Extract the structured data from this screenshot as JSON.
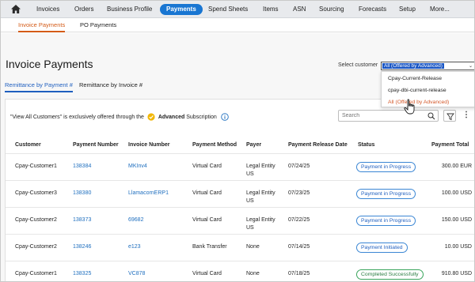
{
  "nav": {
    "items": [
      {
        "label": "Invoices"
      },
      {
        "label": "Orders"
      },
      {
        "label": "Business Profile"
      },
      {
        "label": "Payments"
      },
      {
        "label": "Spend Sheets"
      },
      {
        "label": "Items"
      },
      {
        "label": "ASN"
      },
      {
        "label": "Sourcing"
      },
      {
        "label": "Forecasts"
      },
      {
        "label": "Setup"
      },
      {
        "label": "More..."
      }
    ],
    "active_index": 3
  },
  "subnav": {
    "items": [
      {
        "label": "Invoice Payments"
      },
      {
        "label": "PO Payments"
      }
    ],
    "active_index": 0
  },
  "page": {
    "title": "Invoice Payments",
    "customer_label": "Select customer",
    "customer_selected": "All (Offered by Advanced)",
    "customer_options": [
      "Cpay-Current-Release",
      "cpay-dbi-current-release",
      "All (Offered by Advanced)"
    ]
  },
  "tabs": [
    {
      "label": "Remittance by Payment #"
    },
    {
      "label": "Remittance by Invoice #"
    }
  ],
  "notice": {
    "prefix": "\"View All Customers\" is exclusively offered through the",
    "highlight": "Advanced",
    "suffix": "Subscription"
  },
  "search": {
    "placeholder": "Search"
  },
  "more_label": "⋮",
  "table": {
    "headers": [
      "Customer",
      "Payment Number",
      "Invoice Number",
      "Payment Method",
      "Payer",
      "Payment Release Date",
      "Status",
      "Payment Total"
    ],
    "rows": [
      {
        "customer": "Cpay-Customer1",
        "payment_number": "138384",
        "invoice_number": "MKInv4",
        "method": "Virtual Card",
        "payer_1": "Legal Entity",
        "payer_2": "US",
        "date": "07/24/25",
        "status": "Payment in Progress",
        "total": "300.00 EUR"
      },
      {
        "customer": "Cpay-Customer3",
        "payment_number": "138380",
        "invoice_number": "LlamacornERP1",
        "method": "Virtual Card",
        "payer_1": "Legal Entity",
        "payer_2": "US",
        "date": "07/23/25",
        "status": "Payment in Progress",
        "total": "100.00 USD"
      },
      {
        "customer": "Cpay-Customer2",
        "payment_number": "138373",
        "invoice_number": "69682",
        "method": "Virtual Card",
        "payer_1": "Legal Entity",
        "payer_2": "US",
        "date": "07/22/25",
        "status": "Payment in Progress",
        "total": "150.00 USD"
      },
      {
        "customer": "Cpay-Customer2",
        "payment_number": "138246",
        "invoice_number": "e123",
        "method": "Bank Transfer",
        "payer_1": "None",
        "payer_2": "",
        "date": "07/14/25",
        "status": "Payment Initiated",
        "total": "10.00 USD"
      },
      {
        "customer": "Cpay-Customer1",
        "payment_number": "138325",
        "invoice_number": "VC878",
        "method": "Virtual Card",
        "payer_1": "None",
        "payer_2": "",
        "date": "07/18/25",
        "status": "Completed Successfully",
        "total": "910.80 USD"
      }
    ]
  },
  "colors": {
    "accent_blue": "#1976d2",
    "accent_orange": "#d45b17",
    "status_green": "#2a7d42"
  }
}
